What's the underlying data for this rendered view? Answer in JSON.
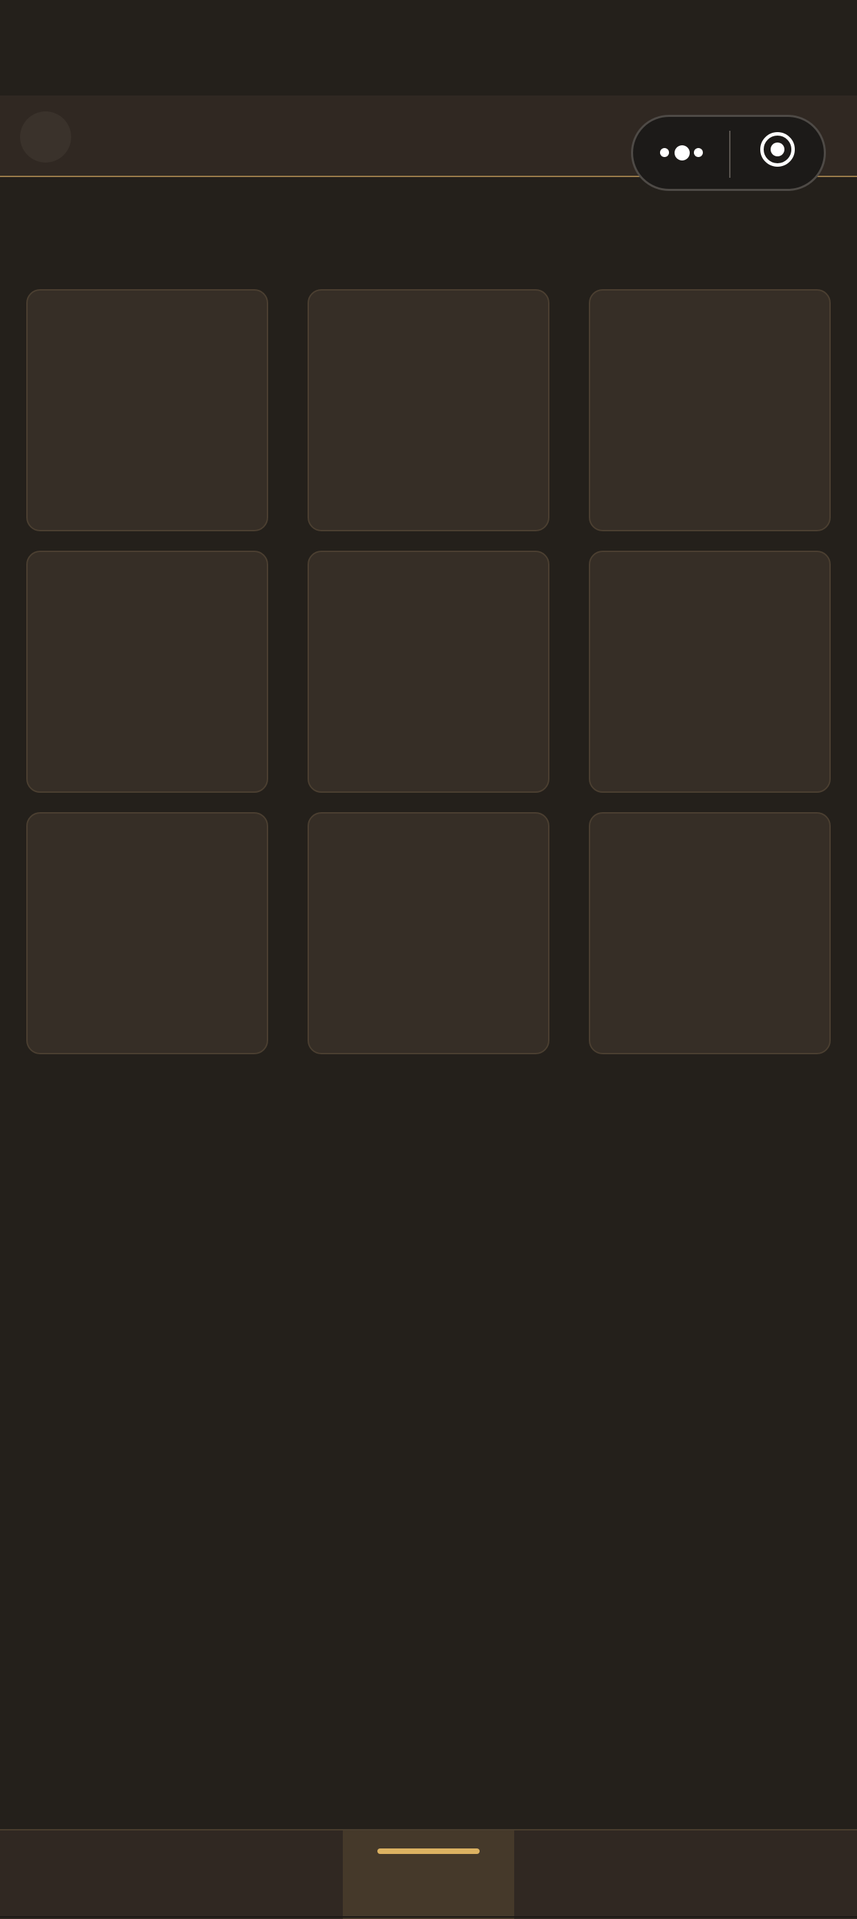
{
  "app": {
    "nav_bar_title": "",
    "colors": {
      "background": "#24201b",
      "nav_bar": "#302822",
      "accent": "#dcb262",
      "nav_border": "#9a7b4a",
      "tile_fill": "#362e26",
      "tile_border": "#4b3f31"
    }
  },
  "capsule": {
    "more_icon": "more-dots-icon",
    "close_icon": "close-target-icon"
  },
  "grid": {
    "rows": 3,
    "columns": 3,
    "tiles": [
      "",
      "",
      "",
      "",
      "",
      "",
      "",
      "",
      ""
    ]
  },
  "tab_bar": {
    "tabs": [
      "",
      "",
      ""
    ],
    "active_index": 1
  }
}
